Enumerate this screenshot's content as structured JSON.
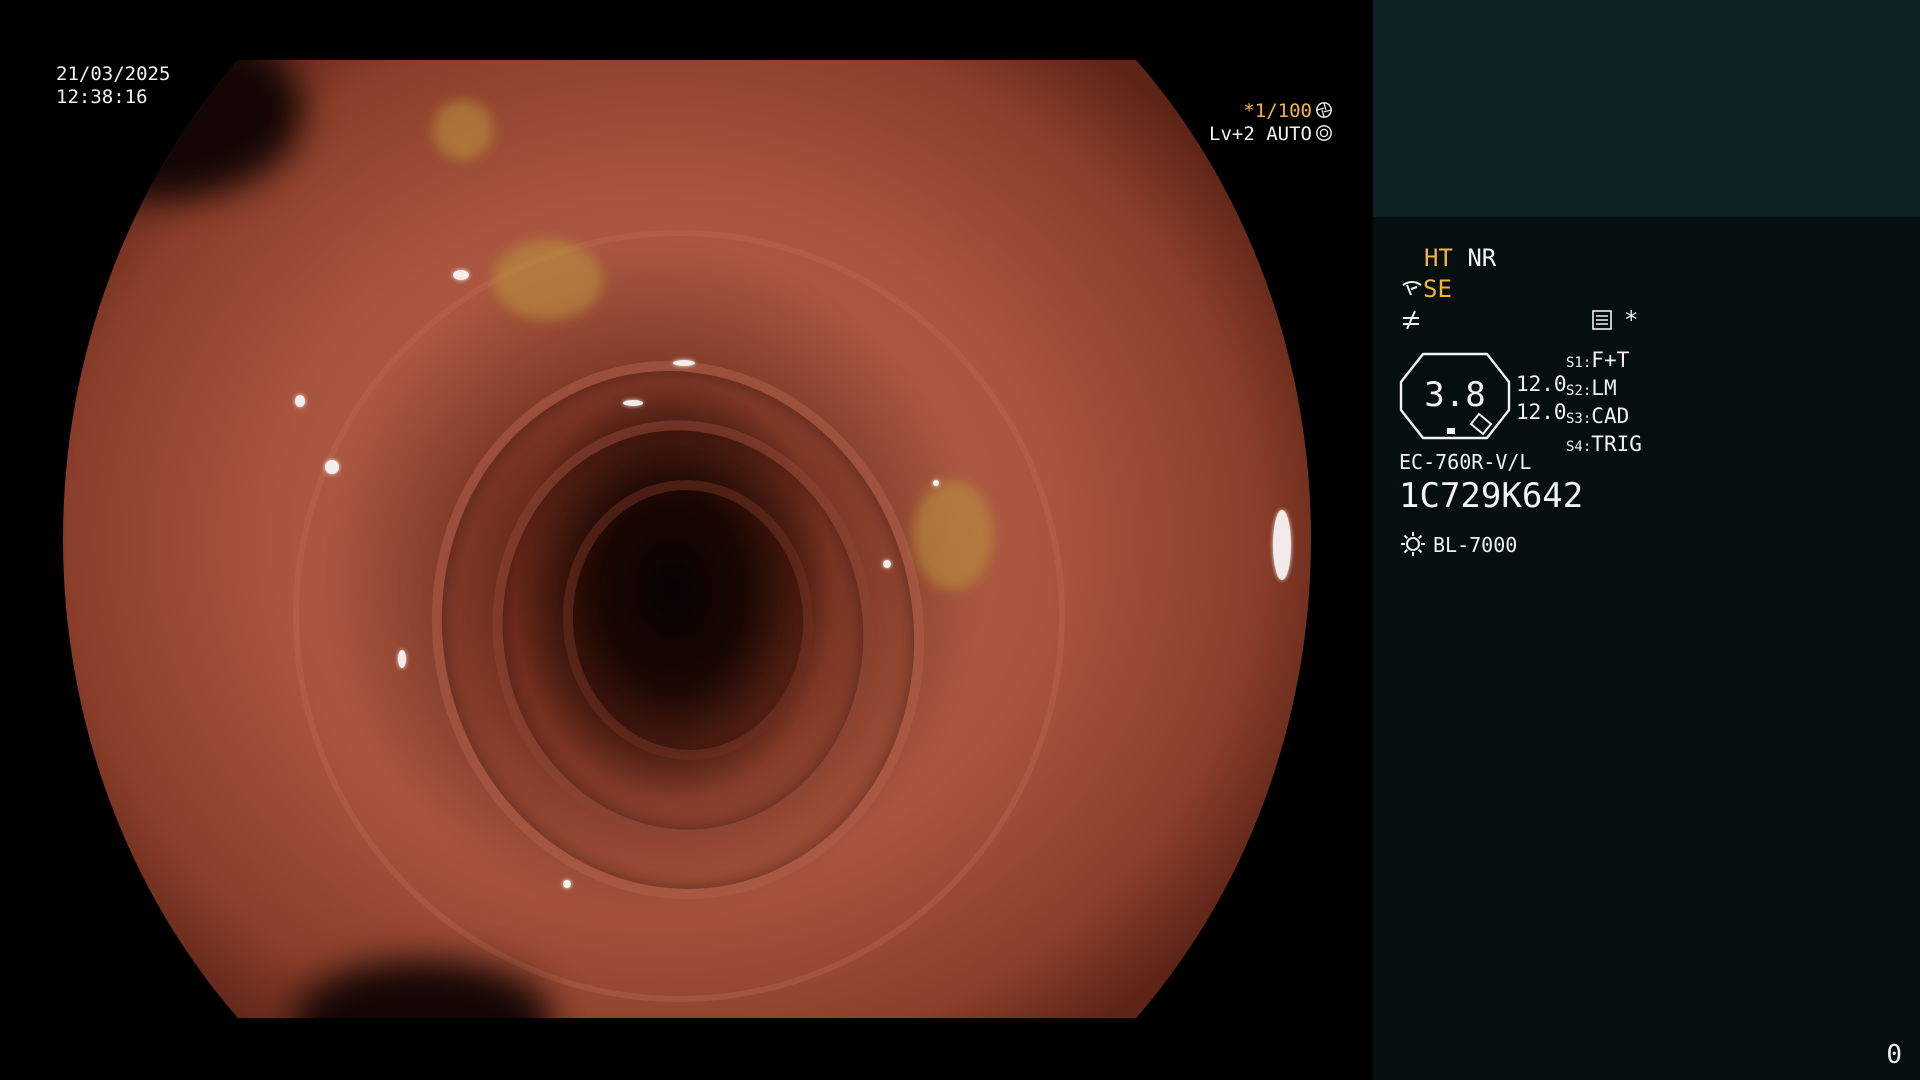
{
  "overlay": {
    "date": "21/03/2025",
    "time": "12:38:16",
    "shutter": "*1/100",
    "exposure": "Lv+2 AUTO",
    "icons": {
      "shutter_icon": "aperture-icon",
      "exposure_icon": "iris-icon"
    }
  },
  "info_panel": {
    "modes": {
      "ht": "HT",
      "nr": "NR",
      "se": "SE",
      "asterisk": "*",
      "icons": [
        "scissor-icon",
        "not-equal-icon",
        "menu-list-icon"
      ]
    },
    "zoom": {
      "value": "3.8",
      "levels": [
        "12.0",
        "12.0"
      ]
    },
    "schedule": [
      {
        "key": "S1:",
        "value": "F+T"
      },
      {
        "key": "S2:",
        "value": "LM"
      },
      {
        "key": "S3:",
        "value": "CAD"
      },
      {
        "key": "S4:",
        "value": "TRIG"
      }
    ],
    "scope_model": "EC-760R-V/L",
    "scope_serial": "1C729K642",
    "light_source": "BL-7000",
    "light_icon": "sun-icon",
    "counter": "0"
  },
  "colors": {
    "amber": "#f5b23c",
    "panel_bg": "#060f0f",
    "preview_bg": "#0d2323",
    "text": "#f2f2f2"
  }
}
